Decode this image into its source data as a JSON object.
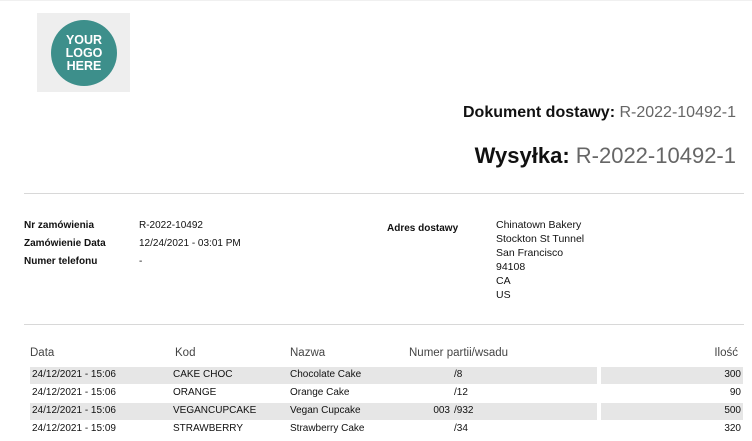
{
  "logo": {
    "text": "YOUR\nLOGO\nHERE",
    "color": "#3d8f8b"
  },
  "header": {
    "document_label": "Dokument dostawy:",
    "document_value": "R-2022-10492-1",
    "shipment_label": "Wysyłka:",
    "shipment_value": "R-2022-10492-1"
  },
  "info": {
    "order_label": "Nr zamówienia",
    "order_value": "R-2022-10492",
    "order_date_label": "Zamówienie Data",
    "order_date_value": "12/24/2021 - 03:01 PM",
    "phone_label": "Numer telefonu",
    "phone_value": "-"
  },
  "address": {
    "label": "Adres dostawy",
    "lines": [
      "Chinatown Bakery",
      "Stockton St Tunnel",
      "San Francisco",
      "94108",
      "CA",
      "US"
    ]
  },
  "table": {
    "columns": [
      "Data",
      "Kod",
      "Nazwa",
      "Numer partii/wsadu",
      "Ilość"
    ],
    "rows": [
      {
        "date": "24/12/2021 - 15:06",
        "code": "CAKE CHOC",
        "name": "Chocolate Cake",
        "batch_prefix": "",
        "batch": "/8",
        "qty": "300"
      },
      {
        "date": "24/12/2021 - 15:06",
        "code": "ORANGE",
        "name": "Orange Cake",
        "batch_prefix": "",
        "batch": "/12",
        "qty": "90"
      },
      {
        "date": "24/12/2021 - 15:06",
        "code": "VEGANCUPCAKE",
        "name": "Vegan Cupcake",
        "batch_prefix": "003",
        "batch": "/932",
        "qty": "500"
      },
      {
        "date": "24/12/2021 - 15:09",
        "code": "STRAWBERRY",
        "name": "Strawberry Cake",
        "batch_prefix": "",
        "batch": "/34",
        "qty": "320"
      }
    ]
  }
}
